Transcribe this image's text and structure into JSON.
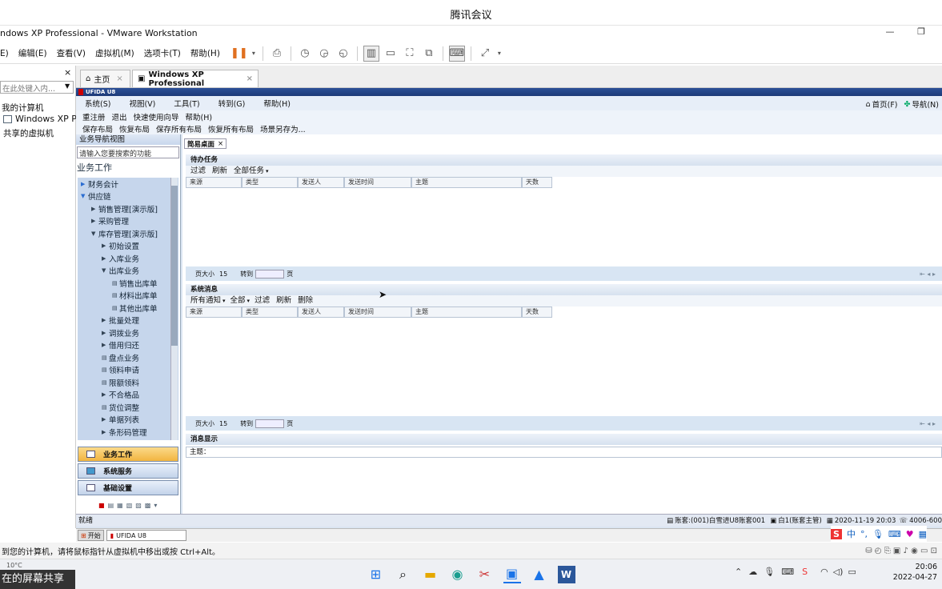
{
  "meeting": {
    "title": "腾讯会议"
  },
  "vmware": {
    "title": "ndows XP Professional - VMware Workstation",
    "menu": [
      "E)",
      "编辑(E)",
      "查看(V)",
      "虚拟机(M)",
      "选项卡(T)",
      "帮助(H)"
    ],
    "library": {
      "search_placeholder": "在此处键入内...",
      "items": [
        "我的计算机",
        "Windows XP P",
        "共享的虚拟机"
      ]
    },
    "tabs": [
      {
        "label": "主页"
      },
      {
        "label": "Windows XP Professional"
      }
    ],
    "status_text": "到您的计算机，请将鼠标指针从虚拟机中移出或按 Ctrl+Alt。"
  },
  "u8": {
    "app_title": "UFIDA U8",
    "menu": [
      "系统(S)",
      "视图(V)",
      "工具(T)",
      "转到(G)",
      "帮助(H)"
    ],
    "menu_right": [
      "首页(F)",
      "导航(N)"
    ],
    "toolbar1": [
      "重注册",
      "退出",
      "快速使用向导",
      "帮助(H)"
    ],
    "toolbar2": [
      "保存布局",
      "恢复布局",
      "保存所有布局",
      "恢复所有布局",
      "场景另存为..."
    ],
    "nav": {
      "title": "业务导航视图",
      "search_placeholder": "请输入您要搜索的功能",
      "section": "业务工作",
      "tree": [
        {
          "label": "财务会计",
          "level": 0,
          "icon": "arrow-right"
        },
        {
          "label": "供应链",
          "level": 0,
          "icon": "arrow-down"
        },
        {
          "label": "销售管理[演示版]",
          "level": 1,
          "icon": "arrow-right"
        },
        {
          "label": "采购管理",
          "level": 1,
          "icon": "arrow-right"
        },
        {
          "label": "库存管理[演示版]",
          "level": 1,
          "icon": "arrow-down"
        },
        {
          "label": "初始设置",
          "level": 2,
          "icon": "arrow-right"
        },
        {
          "label": "入库业务",
          "level": 2,
          "icon": "arrow-right"
        },
        {
          "label": "出库业务",
          "level": 2,
          "icon": "arrow-down"
        },
        {
          "label": "销售出库单",
          "level": 3,
          "icon": "doc"
        },
        {
          "label": "材料出库单",
          "level": 3,
          "icon": "doc"
        },
        {
          "label": "其他出库单",
          "level": 3,
          "icon": "doc"
        },
        {
          "label": "批量处理",
          "level": 2,
          "icon": "arrow-right"
        },
        {
          "label": "调拨业务",
          "level": 2,
          "icon": "arrow-right"
        },
        {
          "label": "借用归还",
          "level": 2,
          "icon": "arrow-right"
        },
        {
          "label": "盘点业务",
          "level": 2,
          "icon": "doc"
        },
        {
          "label": "领料申请",
          "level": 2,
          "icon": "doc"
        },
        {
          "label": "限额领料",
          "level": 2,
          "icon": "doc"
        },
        {
          "label": "不合格品",
          "level": 2,
          "icon": "arrow-right"
        },
        {
          "label": "货位调整",
          "level": 2,
          "icon": "doc"
        },
        {
          "label": "单据列表",
          "level": 2,
          "icon": "arrow-right"
        },
        {
          "label": "条形码管理",
          "level": 2,
          "icon": "arrow-right"
        }
      ],
      "buttons": [
        "业务工作",
        "系统服务",
        "基础设置"
      ]
    },
    "content_tab": "简易桌面",
    "todo": {
      "title": "待办任务",
      "tools": [
        "过滤",
        "刷新",
        "全部任务"
      ],
      "columns": [
        "来源",
        "类型",
        "发送人",
        "发送时间",
        "主题",
        "天数"
      ]
    },
    "sysmsg": {
      "title": "系统消息",
      "tools": [
        "所有通知",
        "全部",
        "过滤",
        "刷新",
        "删除"
      ],
      "columns": [
        "来源",
        "类型",
        "发送人",
        "发送时间",
        "主题",
        "天数"
      ]
    },
    "pager": {
      "size_label": "页大小",
      "size": "15",
      "goto_label": "转到",
      "page_label": "页"
    },
    "msgshow": {
      "title": "消息显示",
      "subject_label": "主题："
    },
    "status": {
      "left": "就绪",
      "account": "账套:(001)白雪进U8账套001",
      "user": "白1(账套主管)",
      "datetime": "2020-11-19 20:03",
      "phone": "4006-600"
    }
  },
  "xp_taskbar": {
    "start": "开始",
    "app": "UFIDA U8"
  },
  "windows": {
    "share_label": "在的屏幕共享",
    "time": "20:06",
    "date": "2022-04-27",
    "weather": "10°C",
    "ime": "中"
  }
}
